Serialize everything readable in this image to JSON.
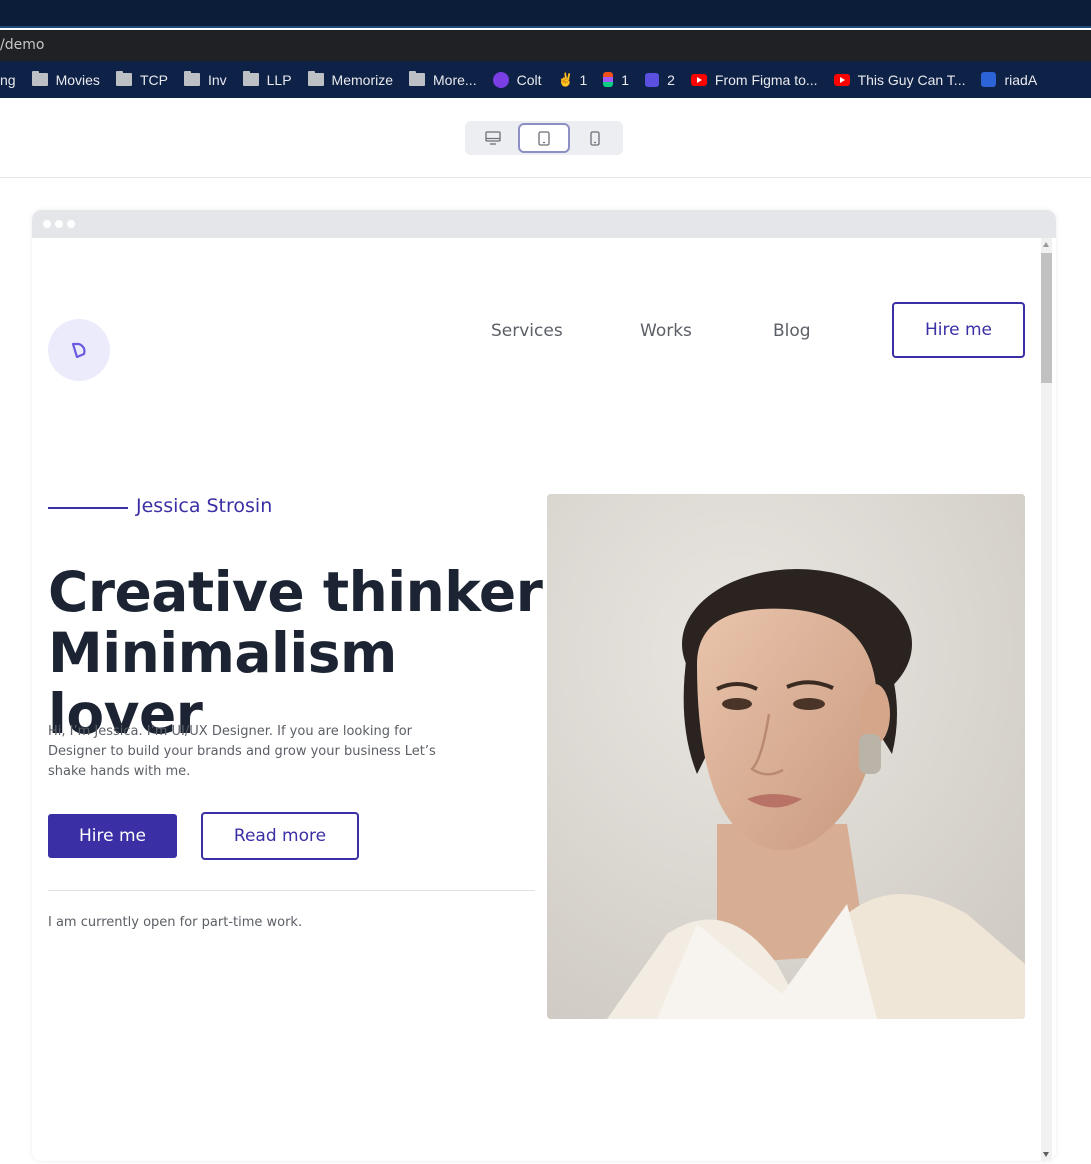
{
  "browser": {
    "url": "/demo",
    "bookmarks": [
      {
        "label": "ng",
        "icon": "none"
      },
      {
        "label": "Movies",
        "icon": "folder-icon"
      },
      {
        "label": "TCP",
        "icon": "folder-icon"
      },
      {
        "label": "Inv",
        "icon": "folder-icon"
      },
      {
        "label": "LLP",
        "icon": "folder-icon"
      },
      {
        "label": "Memorize",
        "icon": "folder-icon"
      },
      {
        "label": "More...",
        "icon": "folder-icon"
      },
      {
        "label": "Colt",
        "icon": "colt-icon"
      },
      {
        "label": "1",
        "icon": "peace-hand-icon"
      },
      {
        "label": "1",
        "icon": "figma-icon"
      },
      {
        "label": "2",
        "icon": "square-app-icon"
      },
      {
        "label": "From Figma to...",
        "icon": "youtube-icon"
      },
      {
        "label": "This Guy Can T...",
        "icon": "youtube-icon"
      },
      {
        "label": "riadA",
        "icon": "bank-icon"
      }
    ]
  },
  "device_switcher": {
    "options": [
      "desktop-icon",
      "tablet-icon",
      "mobile-icon"
    ],
    "active": "tablet-icon"
  },
  "site": {
    "nav": {
      "services": "Services",
      "works": "Works",
      "blog": "Blog",
      "hire": "Hire me"
    },
    "hero": {
      "name": "Jessica Strosin",
      "headline_line1": "Creative thinker",
      "headline_line2": "Minimalism lover",
      "intro": "Hi, I’m Jessica. I’m UI/UX Designer. If you are looking for Designer to build your brands and grow your business Let’s shake hands with me.",
      "primary_button": "Hire me",
      "secondary_button": "Read more",
      "status": "I am currently open for part-time work."
    }
  },
  "colors": {
    "accent": "#3a2fa4",
    "heading": "#1c2433",
    "body_text": "#5b5f66",
    "logo_bg": "#ecebfc"
  }
}
